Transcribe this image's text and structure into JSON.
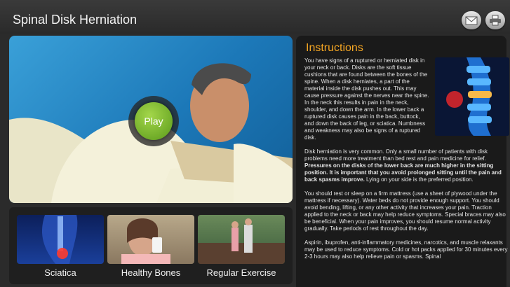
{
  "header": {
    "title": "Spinal Disk Herniation",
    "icons": [
      "mail-icon",
      "print-icon"
    ]
  },
  "video": {
    "play_label": "Play"
  },
  "thumbnails": [
    {
      "label": "Sciatica"
    },
    {
      "label": "Healthy Bones"
    },
    {
      "label": "Regular Exercise"
    }
  ],
  "instructions": {
    "heading": "Instructions",
    "p1": "You have signs of a ruptured or herniated disk in your neck or back. Disks are the soft tissue cushions that are found between the bones of the spine. When a disk herniates, a part of the material inside the disk pushes out. This may cause pressure against the nerves near the spine. In the neck this results in pain in the neck, shoulder, and down the arm. In the lower back a ruptured disk causes pain in the back, buttock, and down the back of leg, or sciatica. Numbness and weakness may also be signs of a ruptured disk.",
    "p2_a": "Disk herniation is very common. Only a small number of patients with disk problems need more treatment than bed rest and pain medicine for relief. ",
    "p2_b": "Pressures on the disks of the lower back are much higher in the sitting position. It is important that you avoid prolonged sitting until the pain and back spasms improve.",
    "p2_c": " Lying on your side is the preferred position.",
    "p3": "You should rest or sleep on a firm mattress (use a sheet of plywood under the mattress if necessary). Water beds do not provide enough support. You should avoid bending, lifting, or any other activity that increases your pain. Traction applied to the neck or back may help reduce symptoms. Special braces may also be beneficial. When your pain improves, you should resume normal activity gradually. Take periods of rest throughout the day.",
    "p4": "Aspirin, ibuprofen, anti-inflammatory medicines, narcotics, and muscle relaxants may be used to reduce symptoms. Cold or hot packs applied for 30 minutes every 2-3 hours may also help relieve pain or spasms. Spinal"
  },
  "colors": {
    "accent": "#f5a623",
    "play": "#7cbf2a",
    "background": "#2b2b2b"
  }
}
